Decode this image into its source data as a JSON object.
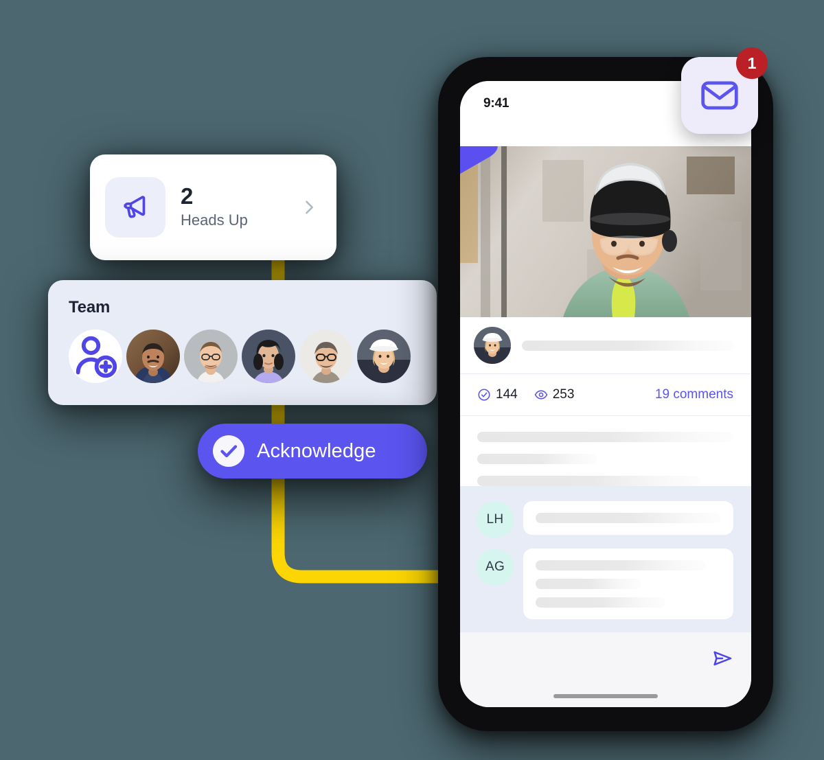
{
  "theme": {
    "background": "#4c6770",
    "accent": "#5b54ef",
    "accent_soft": "#eceefa",
    "card_light": "#e8ecf7",
    "connector_yellow": "#fbd504",
    "badge_red": "#bb2027",
    "initials_bg": "#d6f5ee"
  },
  "heads_up_card": {
    "icon": "megaphone-icon",
    "count": "2",
    "label": "Heads Up",
    "chevron": "chevron-right-icon"
  },
  "team_card": {
    "title": "Team",
    "add_icon": "add-person-icon",
    "members": [
      {
        "name": "member-1"
      },
      {
        "name": "member-2"
      },
      {
        "name": "member-3"
      },
      {
        "name": "member-4"
      },
      {
        "name": "member-5"
      }
    ]
  },
  "acknowledge_button": {
    "label": "Acknowledge",
    "icon": "check-circle-icon"
  },
  "phone": {
    "status_bar": {
      "time": "9:41"
    },
    "video": {
      "play_icon": "play-triangle-icon"
    },
    "author_row": {
      "avatar": "author-avatar"
    },
    "stats": {
      "acknowledged_icon": "check-circle-outline-icon",
      "acknowledged_count": "144",
      "views_icon": "eye-icon",
      "views_count": "253",
      "comments_link": "19 comments"
    },
    "comments": [
      {
        "initials": "LH",
        "lines": 1
      },
      {
        "initials": "AG",
        "lines": 3
      }
    ],
    "composer": {
      "send_icon": "send-icon"
    }
  },
  "mail_tile": {
    "icon": "mail-envelope-icon",
    "badge_count": "1"
  }
}
